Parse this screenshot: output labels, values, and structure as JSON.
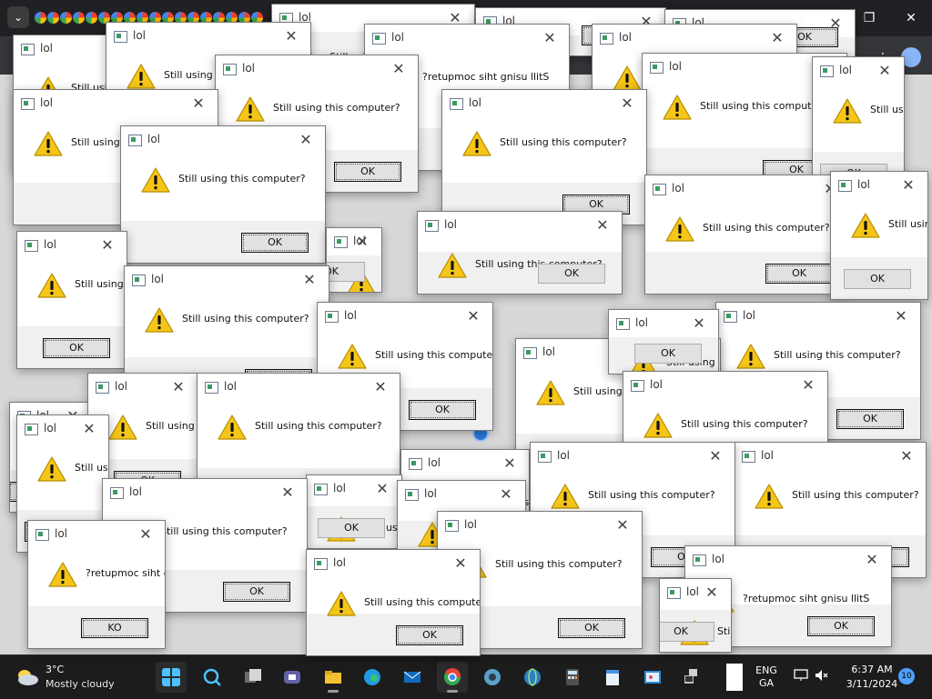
{
  "dialog": {
    "title": "lol",
    "message": "Still using this computer?",
    "message_reversed": "?retupmoc siht gnisu llitS",
    "ok_label": "OK",
    "ok_label_reversed": "KO",
    "close_glyph": "✕"
  },
  "window_controls": {
    "minimize": "—",
    "restore": "❐",
    "close": "✕"
  },
  "taskbar": {
    "weather_temp": "3°C",
    "weather_desc": "Mostly cloudy",
    "lang_line1": "ENG",
    "lang_line2": "GA",
    "time": "6:37 AM",
    "date": "3/11/2024",
    "notification_count": "10",
    "apps": [
      "start",
      "search",
      "task-view",
      "teams",
      "explorer",
      "edge",
      "mail",
      "chrome",
      "edge-dev",
      "calculator",
      "notepad",
      "paint",
      "remote-desktop",
      "blank"
    ]
  },
  "colors": {
    "warning_yellow": "#f5c518",
    "taskbar_bg": "#1c1c1c",
    "accent_blue": "#2a7ad9"
  }
}
